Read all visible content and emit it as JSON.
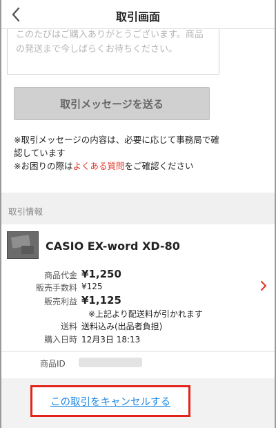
{
  "header": {
    "title": "取引画面"
  },
  "message_box": {
    "text": "このたびはご購入ありがとうございます。商品\nの発送まで今しばらくお待ちください。"
  },
  "send_button": {
    "label": "取引メッセージを送る"
  },
  "notes": {
    "line1": "※取引メッセージの内容は、必要に応じて事務局で確認しています",
    "line2_prefix": "※お困りの際は",
    "line2_link": "よくある質問",
    "line2_suffix": "をご確認ください"
  },
  "section": {
    "label": "取引情報"
  },
  "item": {
    "name": "CASIO EX-word XD-80",
    "details": {
      "price_label": "商品代金",
      "price_value": "¥1,250",
      "fee_label": "販売手数料",
      "fee_value": "¥125",
      "profit_label": "販売利益",
      "profit_value": "¥1,125",
      "profit_note": "※上記より配送料が引かれます",
      "shipping_label": "送料",
      "shipping_value": "送料込み(出品者負担)",
      "purchase_date_label": "購入日時",
      "purchase_date_value": "12月3日 18:13"
    },
    "id_label": "商品ID"
  },
  "cancel": {
    "label": "この取引をキャンセルする"
  },
  "colors": {
    "accent_red": "#e0372b",
    "link_blue": "#1e88e5",
    "highlight_frame": "#e2231a"
  }
}
